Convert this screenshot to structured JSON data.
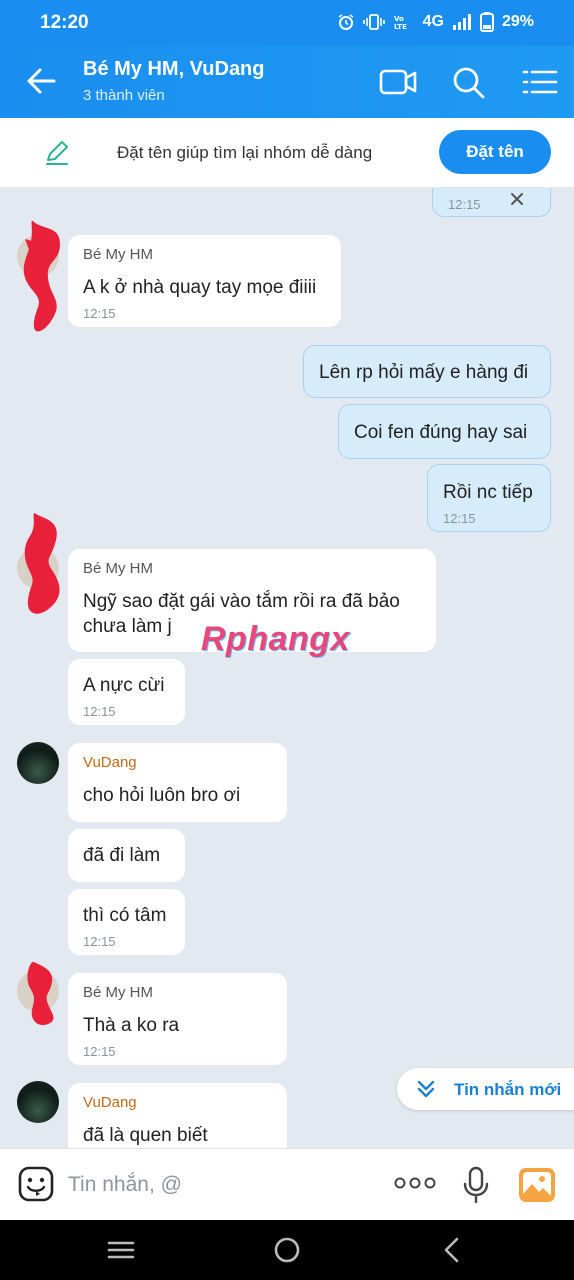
{
  "status_bar": {
    "time": "12:20",
    "network": "4G",
    "battery": "29%",
    "icons": [
      "alarm-icon",
      "vibrate-icon",
      "volte-icon",
      "signal-icon",
      "battery-icon"
    ]
  },
  "header": {
    "title": "Bé My HM, VuDang",
    "subtitle": "3 thành viên",
    "icons": [
      "back-arrow-icon",
      "video-call-icon",
      "search-icon",
      "menu-icon"
    ]
  },
  "banner": {
    "text": "Đặt tên giúp tìm lại nhóm dễ dàng",
    "button": "Đặt tên",
    "icon": "pencil-icon"
  },
  "messages": [
    {
      "id": 0,
      "dir": "out",
      "time": "12:15",
      "icon": "close-icon"
    },
    {
      "id": 1,
      "dir": "in",
      "sender": "Bé My HM",
      "lines": [
        "A k ở nhà quay tay mọe điiii"
      ],
      "time": "12:15"
    },
    {
      "id": 2,
      "dir": "out",
      "lines": [
        "Lên rp hỏi mấy e hàng đi"
      ]
    },
    {
      "id": 3,
      "dir": "out",
      "lines": [
        "Coi fen đúng hay sai"
      ]
    },
    {
      "id": 4,
      "dir": "out",
      "lines": [
        "Rồi nc tiếp"
      ],
      "time": "12:15"
    },
    {
      "id": 5,
      "dir": "in",
      "sender": "Bé My HM",
      "lines": [
        "Ngỹ sao đặt gái vào tắm rồi ra đã bảo",
        "chưa làm j"
      ]
    },
    {
      "id": 6,
      "dir": "in",
      "lines": [
        "A nực cừi"
      ],
      "time": "12:15"
    },
    {
      "id": 7,
      "dir": "in",
      "sender": "VuDang",
      "lines": [
        "cho hỏi luôn bro ơi"
      ]
    },
    {
      "id": 8,
      "dir": "in",
      "lines": [
        "đã đi làm"
      ]
    },
    {
      "id": 9,
      "dir": "in",
      "lines": [
        "thì có tâm"
      ],
      "time": "12:15"
    },
    {
      "id": 10,
      "dir": "in",
      "sender": "Bé My HM",
      "lines": [
        "Thà a ko ra"
      ],
      "time": "12:15"
    },
    {
      "id": 11,
      "dir": "in",
      "sender": "VuDang",
      "lines": [
        "đã là quen biết"
      ]
    }
  ],
  "watermark": "Rphangx",
  "new_messages_button": "Tin nhắn mới",
  "composer": {
    "placeholder": "Tin nhắn, @",
    "icons": [
      "emoji-icon",
      "more-options-icon",
      "microphone-icon",
      "image-icon"
    ]
  },
  "nav_bar": {
    "icons": [
      "recent-apps-icon",
      "home-icon",
      "back-icon"
    ]
  },
  "colors": {
    "accent": "#1a8ef0",
    "chat_bg": "#e2e9f1",
    "outgoing_bubble": "#d7ecfb",
    "incoming_bubble": "#ffffff",
    "sender_alt": "#c4691b",
    "redaction": "#e8203a"
  }
}
